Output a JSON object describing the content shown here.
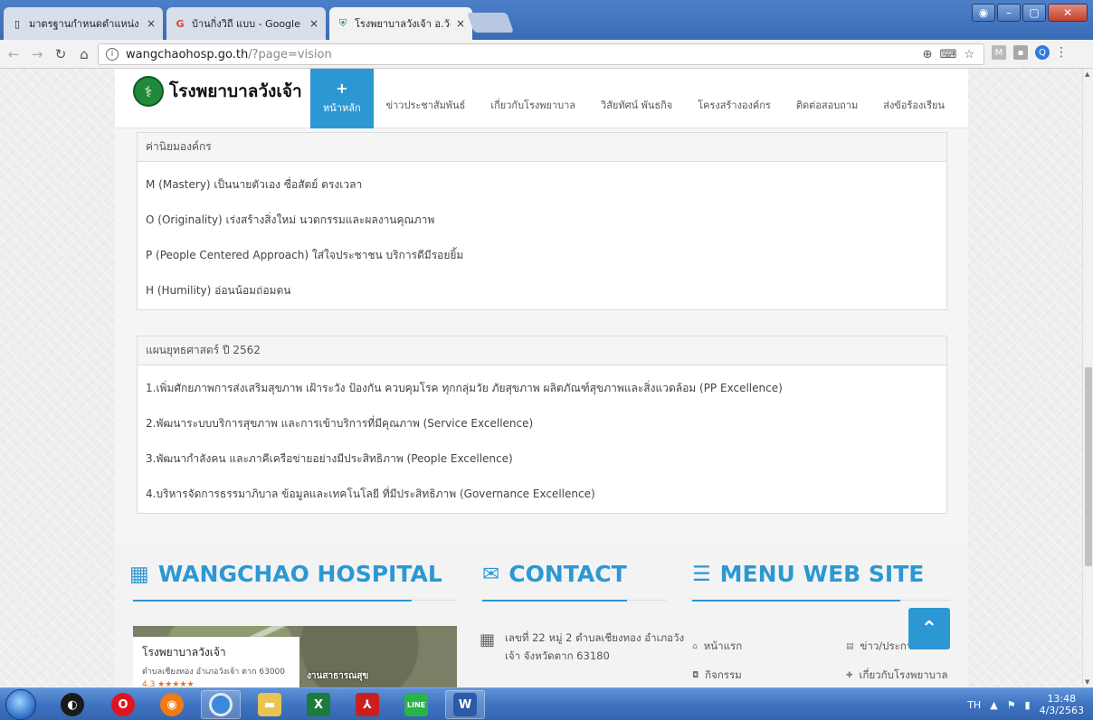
{
  "browser": {
    "tabs": [
      {
        "title": "มาตรฐานกำหนดตำแหน่ง พร",
        "favicon": "document-icon",
        "active": false
      },
      {
        "title": "บ้านกิ่งวิถี แบบ - Google Se",
        "favicon": "google-icon",
        "active": false
      },
      {
        "title": "โรงพยาบาลวังเจ้า อ.วังเจ้า จ.",
        "favicon": "shield-icon",
        "active": true
      }
    ],
    "close_glyph": "×",
    "url_host": "wangchaohosp.go.th",
    "url_path": "/?page=vision",
    "window_controls": {
      "minimize": "–",
      "maximize": "▢",
      "close": "✕"
    },
    "extensions": {
      "m": "M",
      "box": "▪",
      "q": "Q",
      "menu": "⋮"
    }
  },
  "site": {
    "name": "โรงพยาบาลวังเจ้า",
    "nav": [
      {
        "label": "หน้าหลัก",
        "active": true
      },
      {
        "label": "ข่าวประชาสัมพันธ์",
        "active": false
      },
      {
        "label": "เกี่ยวกับโรงพยาบาล",
        "active": false
      },
      {
        "label": "วิสัยทัศน์ พันธกิจ",
        "active": false
      },
      {
        "label": "โครงสร้างองค์กร",
        "active": false
      },
      {
        "label": "ติดต่อสอบถาม",
        "active": false
      },
      {
        "label": "ส่งข้อร้องเรียน",
        "active": false
      }
    ]
  },
  "values_panel": {
    "heading": "ค่านิยมองค์กร",
    "items": [
      "M (Mastery) เป็นนายตัวเอง ซื่อสัตย์ ตรงเวลา",
      "O (Originality) เร่งสร้างสิ่งใหม่ นวตกรรมและผลงานคุณภาพ",
      "P (People Centered Approach) ใส่ใจประชาชน บริการดีมีรอยยิ้ม",
      "H (Humility) อ่อนน้อมถ่อมตน"
    ]
  },
  "strategy_panel": {
    "heading": "แผนยุทธศาสตร์ ปี 2562",
    "items": [
      "1.เพิ่มศักยภาพการส่งเสริมสุขภาพ เฝ้าระวัง ป้องกัน ควบคุมโรค ทุกกลุ่มวัย ภัยสุขภาพ ผลิตภัณฑ์สุขภาพและสิ่งแวดล้อม (PP Excellence)",
      "2.พัฒนาระบบบริการสุขภาพ และการเข้าบริการที่มีคุณภาพ (Service Excellence)",
      "3.พัฒนากำลังคน และภาคีเครือข่ายอย่างมีประสิทธิภาพ (People Excellence)",
      "4.บริหารจัดการธรรมาภิบาล ข้อมูลและเทคโนโลยี ที่มีประสิทธิภาพ (Governance Excellence)"
    ]
  },
  "footer": {
    "hospital_title": "WANGCHAO HOSPITAL",
    "contact_title": "CONTACT",
    "menu_title": "MENU WEB SITE",
    "map_card": {
      "name": "โรงพยาบาลวังเจ้า",
      "address": "ตำบลเชียงทอง อำเภอวังเจ้า ตาก 63000",
      "rating": "4.3 ★★★★★"
    },
    "map_label": "งานสาธารณสุข",
    "contact_address": "เลขที่ 22 หมู่ 2 ตำบลเชียงทอง อำเภอวังเจ้า จังหวัดตาก 63180",
    "menu_links": [
      "หน้าแรก",
      "ข่าว/ประกาศ",
      "กิจกรรม",
      "เกี่ยวกับโรงพยาบาล"
    ]
  },
  "taskbar": {
    "lang": "TH",
    "time": "13:48",
    "date": "4/3/2563",
    "line_label": "LINE"
  },
  "colors": {
    "accent": "#2c98d3",
    "logo_green": "#1f8a3b"
  }
}
